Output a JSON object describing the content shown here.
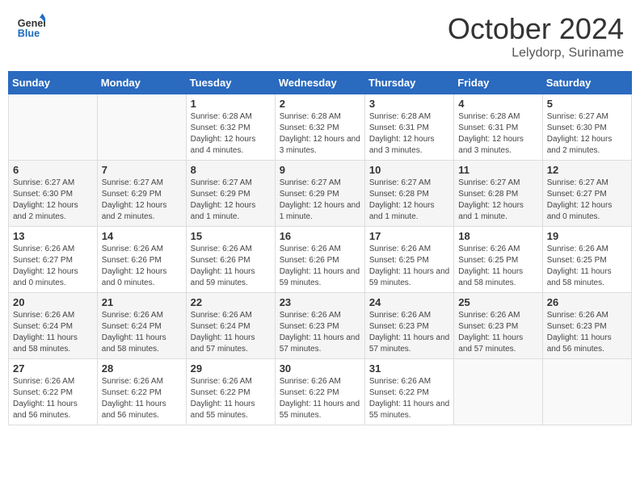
{
  "header": {
    "logo_general": "General",
    "logo_blue": "Blue",
    "month_title": "October 2024",
    "location": "Lelydorp, Suriname"
  },
  "weekdays": [
    "Sunday",
    "Monday",
    "Tuesday",
    "Wednesday",
    "Thursday",
    "Friday",
    "Saturday"
  ],
  "weeks": [
    [
      null,
      null,
      {
        "day": 1,
        "sunrise": "6:28 AM",
        "sunset": "6:32 PM",
        "daylight": "12 hours and 4 minutes."
      },
      {
        "day": 2,
        "sunrise": "6:28 AM",
        "sunset": "6:32 PM",
        "daylight": "12 hours and 3 minutes."
      },
      {
        "day": 3,
        "sunrise": "6:28 AM",
        "sunset": "6:31 PM",
        "daylight": "12 hours and 3 minutes."
      },
      {
        "day": 4,
        "sunrise": "6:28 AM",
        "sunset": "6:31 PM",
        "daylight": "12 hours and 3 minutes."
      },
      {
        "day": 5,
        "sunrise": "6:27 AM",
        "sunset": "6:30 PM",
        "daylight": "12 hours and 2 minutes."
      }
    ],
    [
      {
        "day": 6,
        "sunrise": "6:27 AM",
        "sunset": "6:30 PM",
        "daylight": "12 hours and 2 minutes."
      },
      {
        "day": 7,
        "sunrise": "6:27 AM",
        "sunset": "6:29 PM",
        "daylight": "12 hours and 2 minutes."
      },
      {
        "day": 8,
        "sunrise": "6:27 AM",
        "sunset": "6:29 PM",
        "daylight": "12 hours and 1 minute."
      },
      {
        "day": 9,
        "sunrise": "6:27 AM",
        "sunset": "6:29 PM",
        "daylight": "12 hours and 1 minute."
      },
      {
        "day": 10,
        "sunrise": "6:27 AM",
        "sunset": "6:28 PM",
        "daylight": "12 hours and 1 minute."
      },
      {
        "day": 11,
        "sunrise": "6:27 AM",
        "sunset": "6:28 PM",
        "daylight": "12 hours and 1 minute."
      },
      {
        "day": 12,
        "sunrise": "6:27 AM",
        "sunset": "6:27 PM",
        "daylight": "12 hours and 0 minutes."
      }
    ],
    [
      {
        "day": 13,
        "sunrise": "6:26 AM",
        "sunset": "6:27 PM",
        "daylight": "12 hours and 0 minutes."
      },
      {
        "day": 14,
        "sunrise": "6:26 AM",
        "sunset": "6:26 PM",
        "daylight": "12 hours and 0 minutes."
      },
      {
        "day": 15,
        "sunrise": "6:26 AM",
        "sunset": "6:26 PM",
        "daylight": "11 hours and 59 minutes."
      },
      {
        "day": 16,
        "sunrise": "6:26 AM",
        "sunset": "6:26 PM",
        "daylight": "11 hours and 59 minutes."
      },
      {
        "day": 17,
        "sunrise": "6:26 AM",
        "sunset": "6:25 PM",
        "daylight": "11 hours and 59 minutes."
      },
      {
        "day": 18,
        "sunrise": "6:26 AM",
        "sunset": "6:25 PM",
        "daylight": "11 hours and 58 minutes."
      },
      {
        "day": 19,
        "sunrise": "6:26 AM",
        "sunset": "6:25 PM",
        "daylight": "11 hours and 58 minutes."
      }
    ],
    [
      {
        "day": 20,
        "sunrise": "6:26 AM",
        "sunset": "6:24 PM",
        "daylight": "11 hours and 58 minutes."
      },
      {
        "day": 21,
        "sunrise": "6:26 AM",
        "sunset": "6:24 PM",
        "daylight": "11 hours and 58 minutes."
      },
      {
        "day": 22,
        "sunrise": "6:26 AM",
        "sunset": "6:24 PM",
        "daylight": "11 hours and 57 minutes."
      },
      {
        "day": 23,
        "sunrise": "6:26 AM",
        "sunset": "6:23 PM",
        "daylight": "11 hours and 57 minutes."
      },
      {
        "day": 24,
        "sunrise": "6:26 AM",
        "sunset": "6:23 PM",
        "daylight": "11 hours and 57 minutes."
      },
      {
        "day": 25,
        "sunrise": "6:26 AM",
        "sunset": "6:23 PM",
        "daylight": "11 hours and 57 minutes."
      },
      {
        "day": 26,
        "sunrise": "6:26 AM",
        "sunset": "6:23 PM",
        "daylight": "11 hours and 56 minutes."
      }
    ],
    [
      {
        "day": 27,
        "sunrise": "6:26 AM",
        "sunset": "6:22 PM",
        "daylight": "11 hours and 56 minutes."
      },
      {
        "day": 28,
        "sunrise": "6:26 AM",
        "sunset": "6:22 PM",
        "daylight": "11 hours and 56 minutes."
      },
      {
        "day": 29,
        "sunrise": "6:26 AM",
        "sunset": "6:22 PM",
        "daylight": "11 hours and 55 minutes."
      },
      {
        "day": 30,
        "sunrise": "6:26 AM",
        "sunset": "6:22 PM",
        "daylight": "11 hours and 55 minutes."
      },
      {
        "day": 31,
        "sunrise": "6:26 AM",
        "sunset": "6:22 PM",
        "daylight": "11 hours and 55 minutes."
      },
      null,
      null
    ]
  ]
}
